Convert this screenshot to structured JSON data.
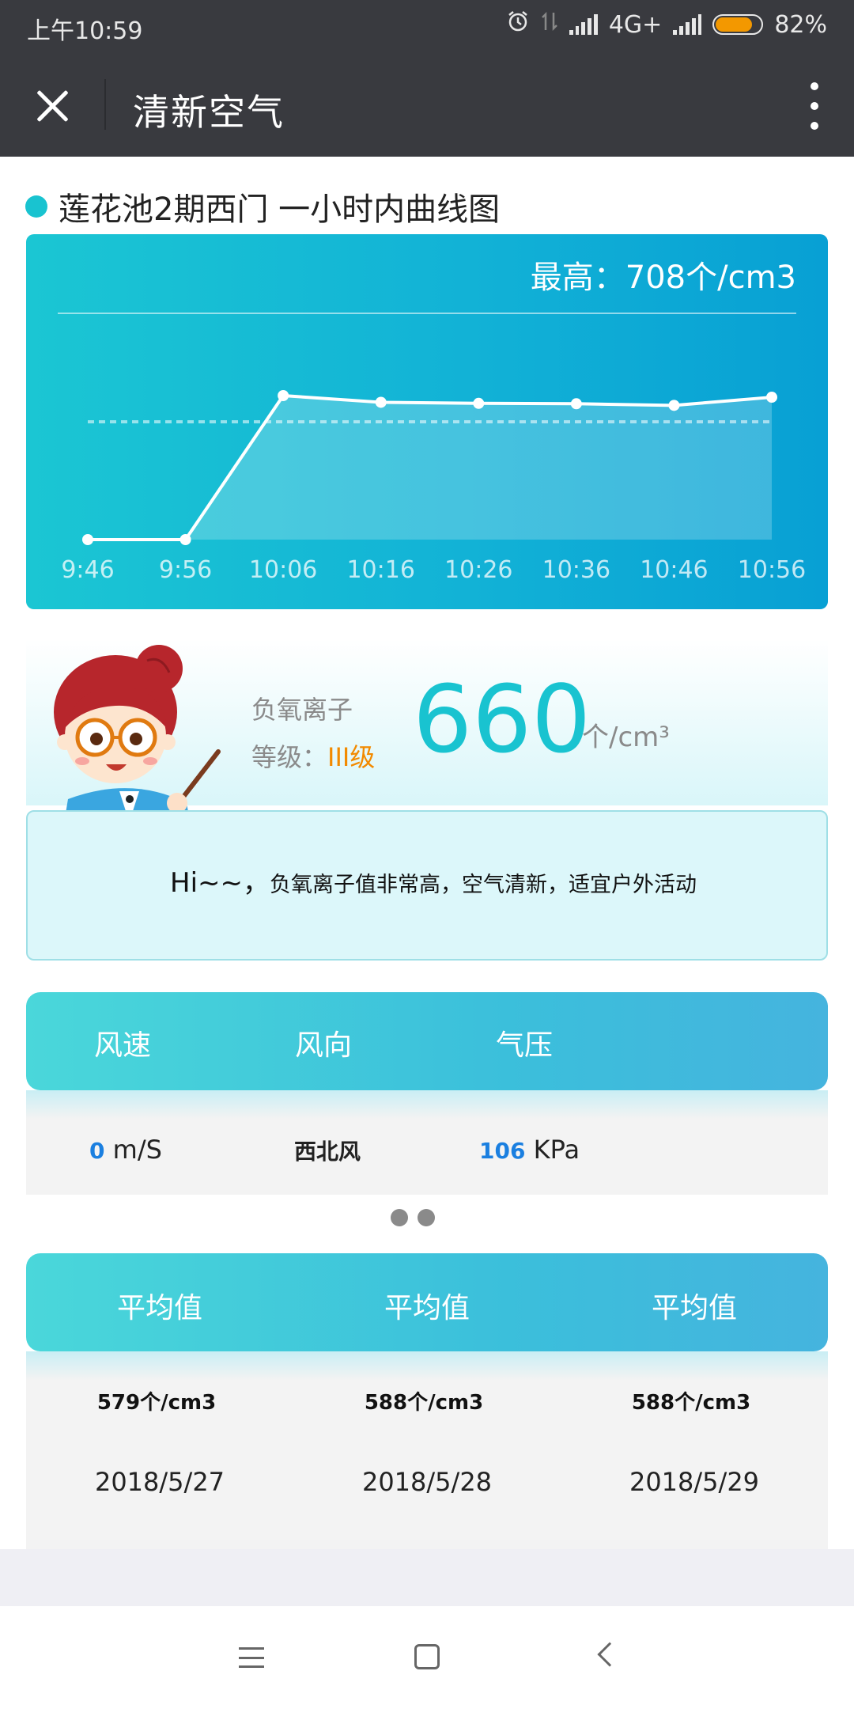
{
  "status_bar": {
    "time": "上午10:59",
    "network": "4G+",
    "battery": "82%",
    "battery_level": 0.82,
    "icons": [
      "alarm-icon",
      "data-transfer-icon",
      "signal-icon",
      "signal-icon",
      "battery-icon"
    ]
  },
  "title_bar": {
    "title": "清新空气",
    "close_icon": "close-icon",
    "more_icon": "more-vertical-icon"
  },
  "page": {
    "heading": "莲花池2期西门 一小时内曲线图"
  },
  "chart": {
    "max_label": "最高：708个/cm3"
  },
  "chart_data": {
    "type": "area",
    "x": [
      "9:46",
      "9:56",
      "10:06",
      "10:16",
      "10:26",
      "10:36",
      "10:46",
      "10:56"
    ],
    "values": [
      0,
      0,
      708,
      675,
      670,
      668,
      660,
      700
    ],
    "ylim": [
      0,
      708
    ],
    "average_line": 579,
    "grid": false,
    "colors": {
      "line": "#ffffff",
      "fill": "rgba(255,255,255,0.22)",
      "avg": "rgba(255,255,255,0.55)"
    }
  },
  "ion": {
    "label": "负氧离子",
    "level_prefix": "等级：",
    "level": "III级",
    "value": "660",
    "unit": "个/cm³",
    "mascot_icon": "teacher-mascot-icon"
  },
  "message": {
    "hi": "Hi~~，",
    "text": "负氧离子值非常高，空气清新，适宜户外活动"
  },
  "weather": {
    "headers": [
      "风速",
      "风向",
      "气压"
    ],
    "wind_speed_value": "0",
    "wind_speed_unit": " m/S",
    "wind_direction": "西北风",
    "pressure_value": "106",
    "pressure_unit": " KPa"
  },
  "pager": {
    "dots": 2
  },
  "averages": {
    "headers": [
      "平均值",
      "平均值",
      "平均值"
    ],
    "values": [
      "579个/cm3",
      "588个/cm3",
      "588个/cm3"
    ],
    "dates": [
      "2018/5/27",
      "2018/5/28",
      "2018/5/29"
    ]
  },
  "nav": {
    "icons": [
      "menu-icon",
      "home-icon",
      "back-icon"
    ]
  }
}
